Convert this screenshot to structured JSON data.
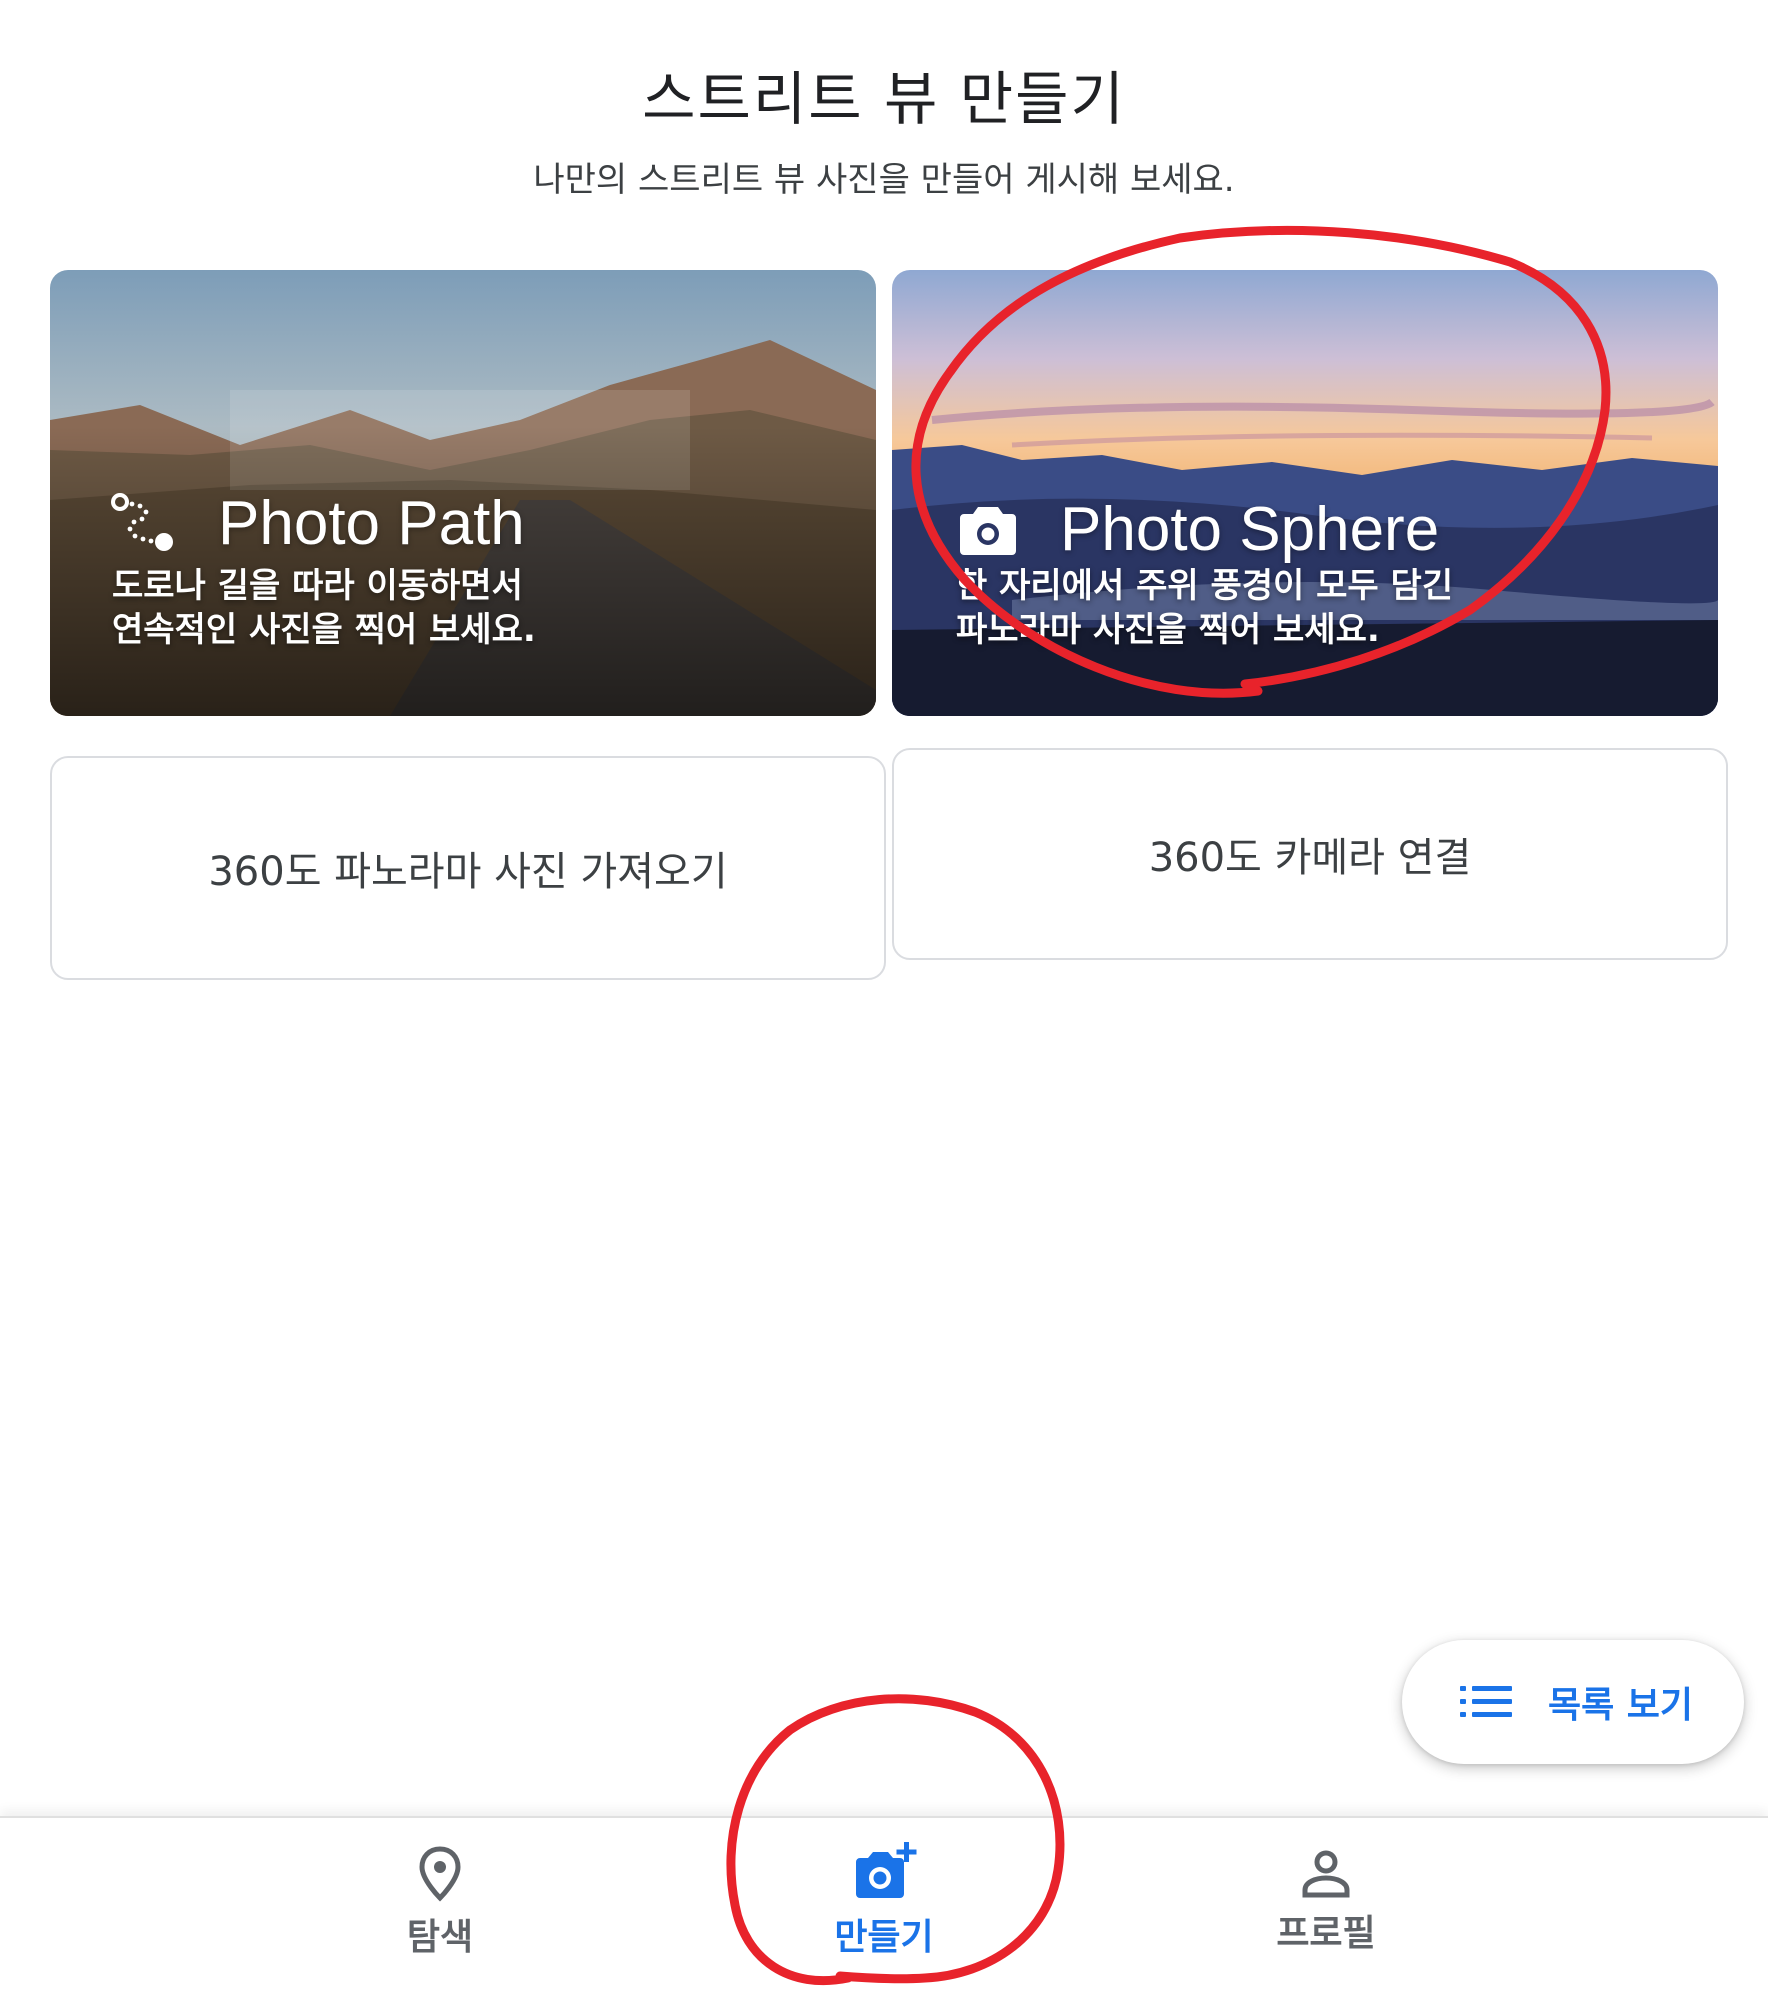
{
  "header": {
    "title": "스트리트 뷰 만들기",
    "subtitle": "나만의 스트리트 뷰 사진을 만들어 게시해 보세요."
  },
  "cards": [
    {
      "title": "Photo Path",
      "icon": "photo-path-icon",
      "desc_lines": [
        "도로나 길을 따라 이동하면서",
        "연속적인 사진을 찍어 보세요."
      ]
    },
    {
      "title": "Photo Sphere",
      "icon": "camera-icon",
      "desc_lines": [
        "한 자리에서 주위 풍경이 모두 담긴",
        "파노라마 사진을 찍어 보세요."
      ]
    }
  ],
  "actions": {
    "import_label": "360도 파노라마 사진 가져오기",
    "connect_label": "360도 카메라 연결"
  },
  "fab": {
    "label": "목록 보기",
    "icon": "list-icon"
  },
  "bottom_nav": {
    "items": [
      {
        "label": "탐색",
        "icon": "location-pin-icon",
        "active": false
      },
      {
        "label": "만들기",
        "icon": "add-camera-icon",
        "active": true
      },
      {
        "label": "프로필",
        "icon": "person-icon",
        "active": false
      }
    ]
  },
  "colors": {
    "accent": "#1a73e8",
    "nav_inactive": "#5f6368",
    "annotation": "#e8232b"
  }
}
